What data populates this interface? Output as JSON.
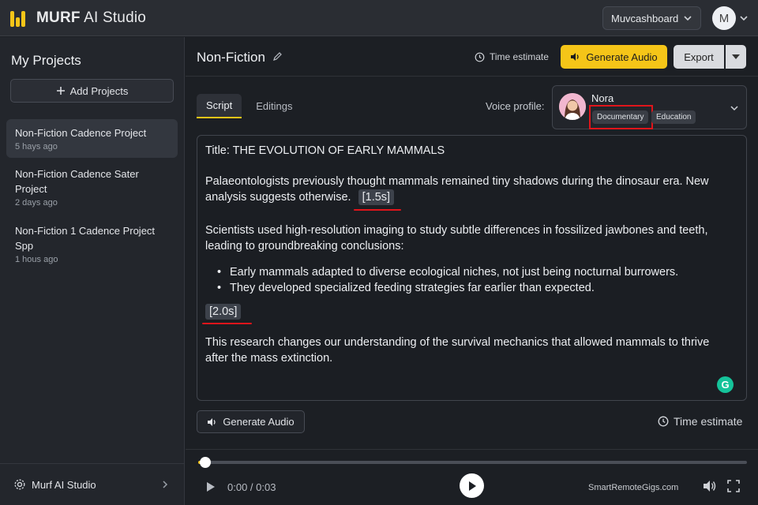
{
  "app": {
    "logo_bold": "MURF",
    "logo_rest": " AI Studio"
  },
  "account": {
    "workspace": "Muvcashboard",
    "avatar_initial": "M"
  },
  "sidebar": {
    "title": "My Projects",
    "add_label": "Add Projects",
    "projects": [
      {
        "name": "Non-Fiction Cadence Project",
        "date": "5 hays ago"
      },
      {
        "name": "Non-Fiction Cadence Sater Project",
        "date": "2 days ago"
      },
      {
        "name": "Non-Fiction 1 Cadence Project Spp",
        "date": "1 hous ago"
      }
    ],
    "footer_label": "Murf AI Studio"
  },
  "header": {
    "title": "Non-Fiction",
    "time_estimate": "Time estimate",
    "generate": "Generate Audio",
    "export": "Export"
  },
  "tabs": [
    {
      "label": "Script"
    },
    {
      "label": "Editings"
    }
  ],
  "voice": {
    "label": "Voice profile:",
    "name": "Nora",
    "tags": [
      "Documentary",
      "Education"
    ]
  },
  "script": {
    "title_line": "Title: THE EVOLUTION OF EARLY MAMMALS",
    "p1_line1": "Palaeontologists previously thought mammals remained tiny shadows during the dinosaur era. New",
    "p1_line2": "analysis suggests otherwise.",
    "pause1": "[1.5s]",
    "p2_line1": "Scientists used high-resolution imaging to study subtle differences in fossilized jawbones and teeth,",
    "p2_line2": "leading to groundbreaking conclusions:",
    "bullets": [
      "Early mammals adapted to diverse ecological niches, not just being nocturnal burrowers.",
      "They developed specialized feeding strategies far earlier than expected."
    ],
    "pause2": "[2.0s]",
    "p3_line1": "This research changes our understanding of the survival mechanics that allowed mammals to thrive",
    "p3_line2": "after the mass extinction.",
    "grammarly": "G"
  },
  "bottom": {
    "generate": "Generate Audio",
    "time_estimate": "Time estimate"
  },
  "player": {
    "time": "0:00 / 0:03",
    "progress": 0.0,
    "watermark": "SmartRemoteGigs.com"
  },
  "colors": {
    "accent": "#f5c518",
    "highlight": "#e0151b"
  }
}
